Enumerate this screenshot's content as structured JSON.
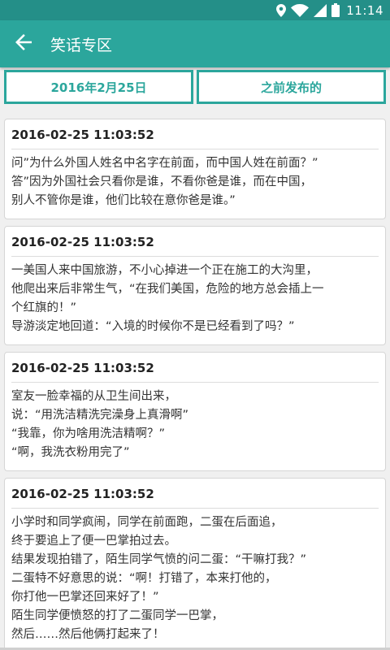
{
  "status_bar": {
    "time": "11:14",
    "icons": [
      "location-icon",
      "wifi-icon",
      "signal-icon",
      "battery-icon"
    ]
  },
  "app_bar": {
    "title": "笑话专区",
    "back_icon": "arrow-left-icon"
  },
  "tabs": [
    {
      "label": "2016年2月25日"
    },
    {
      "label": "之前发布的"
    }
  ],
  "jokes": [
    {
      "date": "2016-02-25 11:03:52",
      "lines": [
        "问”为什么外国人姓名中名字在前面，而中国人姓在前面？”",
        "答”因为外国社会只看你是谁，不看你爸是谁，而在中国，",
        "别人不管你是谁，他们比较在意你爸是谁。”"
      ]
    },
    {
      "date": "2016-02-25 11:03:52",
      "lines": [
        "一美国人来中国旅游，不小心掉进一个正在施工的大沟里，",
        "他爬出来后非常生气，“在我们美国，危险的地方总会插上一",
        "个红旗的！”",
        "导游淡定地回道：“入境的时候你不是已经看到了吗？”"
      ]
    },
    {
      "date": "2016-02-25 11:03:52",
      "lines": [
        "室友一脸幸福的从卫生间出来，",
        "说：“用洗洁精洗完澡身上真滑啊”",
        "“我靠，你为啥用洗洁精啊？”",
        "“啊，我洗衣粉用完了”"
      ]
    },
    {
      "date": "2016-02-25 11:03:52",
      "lines": [
        "小学时和同学疯闹，同学在前面跑，二蛋在后面追，",
        "终于要追上了便一巴掌拍过去。",
        "结果发现拍错了，陌生同学气愤的问二蛋：“干嘛打我？”",
        "二蛋特不好意思的说：“啊！打错了，本来打他的，",
        "你打他一巴掌还回来好了！”",
        "陌生同学便愤怒的打了二蛋同学一巴掌，",
        "然后……然后他俩打起来了！"
      ]
    }
  ]
}
